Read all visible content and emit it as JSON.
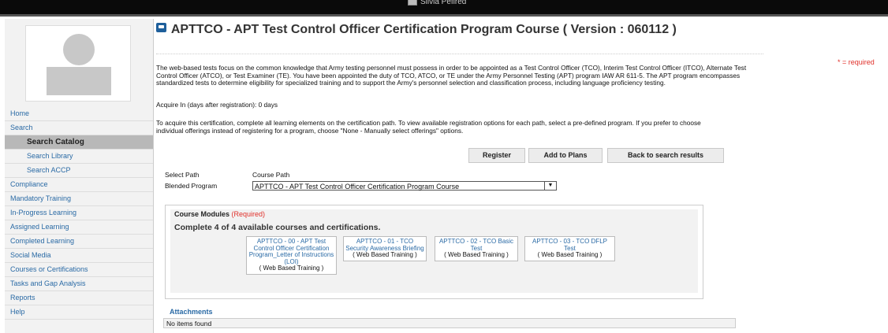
{
  "header": {
    "user_name": "Silvia Pefired"
  },
  "sidebar": {
    "items": [
      {
        "label": "Home"
      },
      {
        "label": "Search"
      },
      {
        "label": "Search Catalog"
      },
      {
        "label": "Search Library"
      },
      {
        "label": "Search ACCP"
      },
      {
        "label": "Compliance"
      },
      {
        "label": "Mandatory Training"
      },
      {
        "label": "In-Progress Learning"
      },
      {
        "label": "Assigned Learning"
      },
      {
        "label": "Completed Learning"
      },
      {
        "label": "Social Media"
      },
      {
        "label": "Courses or Certifications"
      },
      {
        "label": "Tasks and Gap Analysis"
      },
      {
        "label": "Reports"
      },
      {
        "label": "Help"
      }
    ],
    "active_item": "Search Catalog"
  },
  "page": {
    "title": "APTTCO - APT Test Control Officer Certification Program Course ( Version : 060112 )",
    "required_note": "* = required",
    "description": "The web-based tests focus on the common knowledge that Army testing personnel must possess in order to be appointed as a Test Control Officer (TCO), Interim Test Control Officer (ITCO), Alternate Test Control Officer (ATCO), or Test Examiner (TE). You have been appointed the duty of TCO, ATCO, or TE under the Army Personnel Testing (APT) program IAW AR 611-5. The APT program encompasses standardized tests to determine eligibility for specialized training and to support the Army's personnel selection and classification process, including language proficiency testing.",
    "acquire_in": "Acquire In (days after registration): 0 days",
    "instructions": "To acquire this certification, complete all learning elements on the certification path. To view available registration options for each path, select a pre-defined program. If you prefer to choose individual offerings instead of registering for a program, choose \"None - Manually select offerings\" options."
  },
  "actions": {
    "register": "Register",
    "add_to_plans": "Add to Plans",
    "back": "Back to search results"
  },
  "path": {
    "select_path_label": "Select Path",
    "course_path_label": "Course Path",
    "blended_label": "Blended Program",
    "selected_program": "APTTCO - APT Test Control Officer Certification Program Course"
  },
  "modules": {
    "heading": "Course Modules",
    "required": "(Required)",
    "summary": "Complete 4 of 4 available courses and certifications.",
    "items": [
      {
        "title": "APTTCO - 00 - APT Test Control Officer Certification Program_Letter of Instructions (LOI)",
        "type": "( Web Based Training )"
      },
      {
        "title": "APTTCO - 01 - TCO Security Awareness Briefing",
        "type": "( Web Based Training )"
      },
      {
        "title": "APTTCO - 02 - TCO Basic Test",
        "type": "( Web Based Training )"
      },
      {
        "title": "APTTCO - 03 - TCO DFLP Test",
        "type": "( Web Based Training )"
      }
    ]
  },
  "attachments": {
    "heading": "Attachments",
    "empty_text": "No items found"
  },
  "colors": {
    "link": "#2a6aa5",
    "required": "#e0302a",
    "active_nav": "#b8b8b8"
  }
}
